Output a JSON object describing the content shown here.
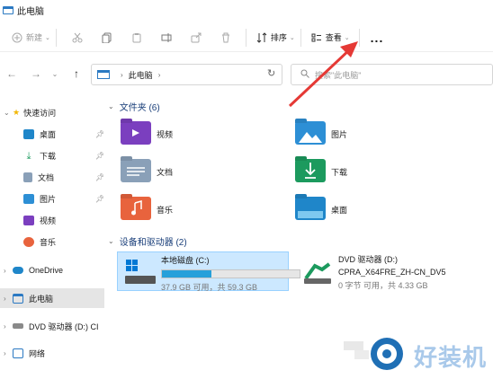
{
  "window": {
    "title": "此电脑"
  },
  "toolbar": {
    "new_label": "新建",
    "sort_label": "排序",
    "view_label": "查看",
    "more_label": "..."
  },
  "address": {
    "location": "此电脑",
    "search_placeholder": "搜索\"此电脑\""
  },
  "nav": {
    "quick_access": "快速访问",
    "items": [
      {
        "label": "桌面"
      },
      {
        "label": "下载"
      },
      {
        "label": "文档"
      },
      {
        "label": "图片"
      },
      {
        "label": "视频"
      },
      {
        "label": "音乐"
      }
    ],
    "onedrive": "OneDrive",
    "this_pc": "此电脑",
    "dvd": "DVD 驱动器 (D:) CI",
    "network": "网络"
  },
  "content": {
    "folders_header": "文件夹 (6)",
    "folders": [
      {
        "label": "视频",
        "color": "#7b3fbf"
      },
      {
        "label": "图片",
        "color": "#2d8fd5"
      },
      {
        "label": "文档",
        "color": "#8aa0b8"
      },
      {
        "label": "下载",
        "color": "#1c9a5e"
      },
      {
        "label": "音乐",
        "color": "#e8633d"
      },
      {
        "label": "桌面",
        "color": "#1f86c9"
      }
    ],
    "drives_header": "设备和驱动器 (2)",
    "drive_c": {
      "name": "本地磁盘 (C:)",
      "free": "37.9 GB 可用，共 59.3 GB",
      "used_fraction": 0.36
    },
    "drive_d": {
      "name": "DVD 驱动器 (D:)",
      "label": "CPRA_X64FRE_ZH-CN_DV5",
      "free": "0 字节 可用，共 4.33 GB"
    }
  },
  "watermark": {
    "text": "好装机"
  },
  "colors": {
    "accent": "#2b79c2",
    "arrow": "#e53935",
    "selection": "#cce8ff"
  }
}
